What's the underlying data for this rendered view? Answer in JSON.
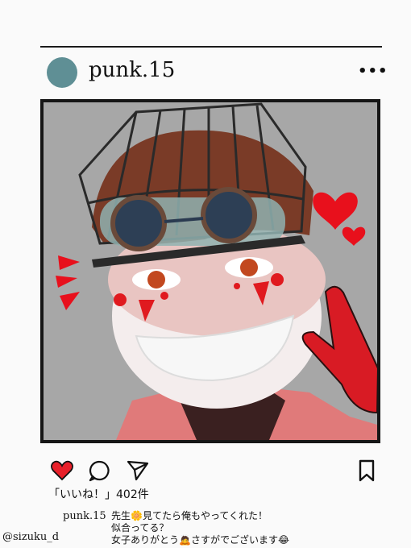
{
  "post": {
    "username": "punk.15",
    "more_label": "•••",
    "likes_text": "「いいね！」402件",
    "caption_user": "punk.15",
    "caption_lines": [
      "先生🌼見てたら俺もやってくれた！",
      "似合ってる？",
      "女子ありがとう🙇さすがでございます😂"
    ]
  },
  "icons": {
    "like": "heart-icon",
    "comment": "comment-bubble-icon",
    "share": "paper-plane-icon",
    "save": "bookmark-icon",
    "more": "more-dots-icon"
  },
  "colors": {
    "avatar": "#5f8f95",
    "heart": "#e8202a",
    "frame_bg": "#a7a7a7",
    "accent_red": "#e01a1f"
  },
  "signature": "@sizuku_d"
}
